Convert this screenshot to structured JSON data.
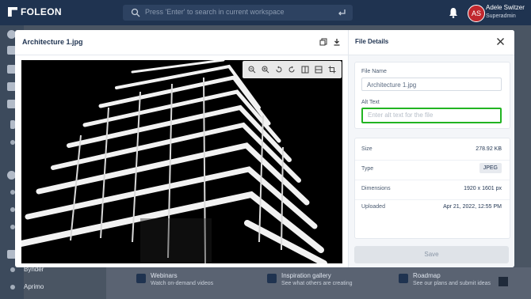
{
  "app": {
    "logo": "FOLEON"
  },
  "search": {
    "placeholder": "Press 'Enter' to search in current workspace"
  },
  "user": {
    "name": "Adele Switzer",
    "role": "Superadmin",
    "initials": "AS"
  },
  "sidebar": {
    "items": [
      {
        "label": "Bynder"
      },
      {
        "label": "Aprimo"
      }
    ]
  },
  "background_cards": [
    {
      "title": "Webinars",
      "subtitle": "Watch on-demand videos"
    },
    {
      "title": "Inspiration gallery",
      "subtitle": "See what others are creating"
    },
    {
      "title": "Roadmap",
      "subtitle": "See our plans and submit ideas"
    }
  ],
  "viewer": {
    "file_title": "Architecture 1.jpg"
  },
  "details": {
    "title": "File Details",
    "file_name_label": "File Name",
    "file_name_value": "Architecture 1.jpg",
    "alt_text_label": "Alt Text",
    "alt_text_placeholder": "Enter alt text for the file",
    "rows": [
      {
        "label": "Size",
        "value": "278.92 KB"
      },
      {
        "label": "Type",
        "value": "JPEG"
      },
      {
        "label": "Dimensions",
        "value": "1920 x 1601 px"
      },
      {
        "label": "Uploaded",
        "value": "Apr 21, 2022, 12:55 PM"
      }
    ],
    "save_label": "Save"
  },
  "colors": {
    "accent_navy": "#1f3350",
    "focus_green": "#22b422",
    "avatar_red": "#c0272d"
  }
}
